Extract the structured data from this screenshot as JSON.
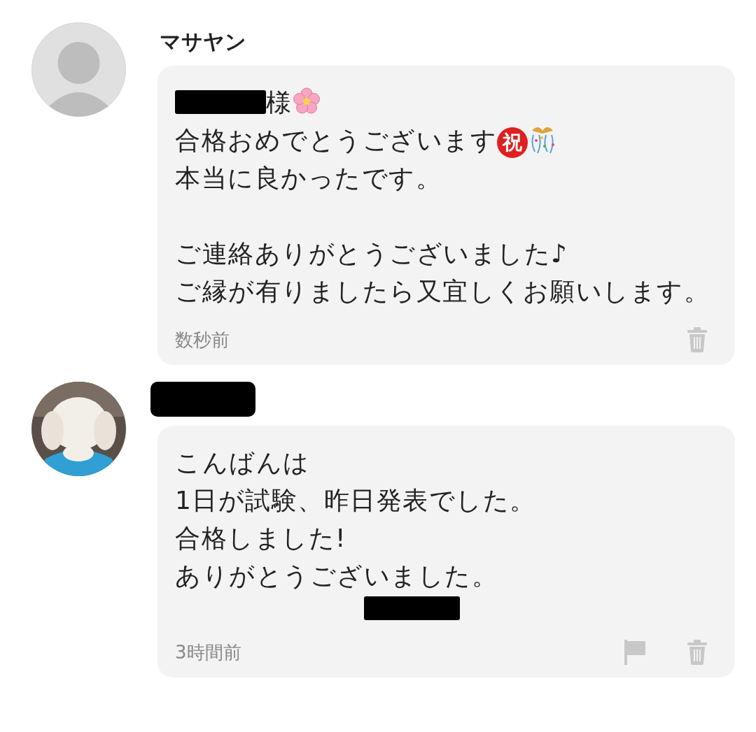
{
  "messages": [
    {
      "author": {
        "name": "マサヤン",
        "name_redacted": false
      },
      "avatar": {
        "kind": "default"
      },
      "paragraphs": [
        [
          {
            "segments": [
              {
                "kind": "redaction"
              },
              {
                "kind": "text",
                "text": "様"
              },
              {
                "kind": "blossom"
              }
            ]
          },
          {
            "segments": [
              {
                "kind": "text",
                "text": "合格おめでとうございます"
              },
              {
                "kind": "badge",
                "text": "祝"
              },
              {
                "kind": "confetti"
              }
            ]
          },
          {
            "segments": [
              {
                "kind": "text",
                "text": "本当に良かったです。"
              }
            ]
          }
        ],
        [
          {
            "segments": [
              {
                "kind": "text",
                "text": "ご連絡ありがとうございました♪"
              }
            ]
          },
          {
            "segments": [
              {
                "kind": "text",
                "text": "ご縁が有りましたら又宜しくお願いします。"
              }
            ]
          }
        ]
      ],
      "time": "数秒前",
      "actions": [
        {
          "kind": "delete"
        }
      ]
    },
    {
      "author": {
        "name_redacted": true
      },
      "avatar": {
        "kind": "picture"
      },
      "paragraphs": [
        [
          {
            "segments": [
              {
                "kind": "text",
                "text": "こんばんは"
              }
            ]
          },
          {
            "segments": [
              {
                "kind": "text",
                "text": "1日が試験、昨日発表でした。"
              }
            ]
          },
          {
            "segments": [
              {
                "kind": "text",
                "text": "合格しました!"
              }
            ]
          },
          {
            "segments": [
              {
                "kind": "text",
                "text": "ありがとうございました。"
              }
            ]
          },
          {
            "segments": [
              {
                "kind": "redaction"
              }
            ]
          }
        ]
      ],
      "time": "3時間前",
      "actions": [
        {
          "kind": "report"
        },
        {
          "kind": "delete"
        }
      ]
    }
  ]
}
